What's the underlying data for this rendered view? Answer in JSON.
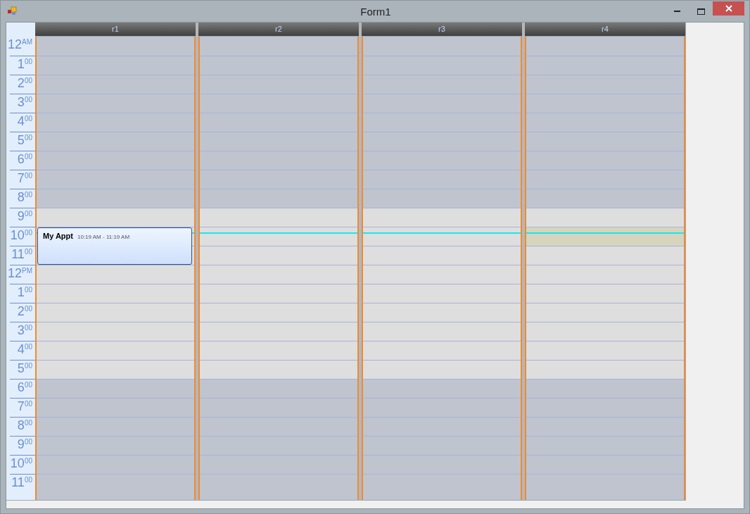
{
  "window": {
    "title": "Form1"
  },
  "columns": [
    {
      "label": "r1",
      "selected": false,
      "appointments": [
        {
          "title": "My Appt",
          "time": "10:19 AM - 11:19 AM"
        }
      ]
    },
    {
      "label": "r2",
      "selected": false
    },
    {
      "label": "r3",
      "selected": false
    },
    {
      "label": "r4",
      "selected": true
    }
  ],
  "hours": [
    {
      "hour": "12",
      "mark": "AM",
      "work": false,
      "now": false,
      "selected": false
    },
    {
      "hour": "1",
      "mark": "00",
      "work": false,
      "now": false,
      "selected": false
    },
    {
      "hour": "2",
      "mark": "00",
      "work": false,
      "now": false,
      "selected": false
    },
    {
      "hour": "3",
      "mark": "00",
      "work": false,
      "now": false,
      "selected": false
    },
    {
      "hour": "4",
      "mark": "00",
      "work": false,
      "now": false,
      "selected": false
    },
    {
      "hour": "5",
      "mark": "00",
      "work": false,
      "now": false,
      "selected": false
    },
    {
      "hour": "6",
      "mark": "00",
      "work": false,
      "now": false,
      "selected": false
    },
    {
      "hour": "7",
      "mark": "00",
      "work": false,
      "now": false,
      "selected": false
    },
    {
      "hour": "8",
      "mark": "00",
      "work": false,
      "now": false,
      "selected": false
    },
    {
      "hour": "9",
      "mark": "00",
      "work": true,
      "now": false,
      "selected": false
    },
    {
      "hour": "10",
      "mark": "00",
      "work": true,
      "now": true,
      "selected": true
    },
    {
      "hour": "11",
      "mark": "00",
      "work": true,
      "now": false,
      "selected": false
    },
    {
      "hour": "12",
      "mark": "PM",
      "work": true,
      "now": false,
      "selected": false
    },
    {
      "hour": "1",
      "mark": "00",
      "work": true,
      "now": false,
      "selected": false
    },
    {
      "hour": "2",
      "mark": "00",
      "work": true,
      "now": false,
      "selected": false
    },
    {
      "hour": "3",
      "mark": "00",
      "work": true,
      "now": false,
      "selected": false
    },
    {
      "hour": "4",
      "mark": "00",
      "work": true,
      "now": false,
      "selected": false
    },
    {
      "hour": "5",
      "mark": "00",
      "work": true,
      "now": false,
      "selected": false
    },
    {
      "hour": "6",
      "mark": "00",
      "work": false,
      "now": false,
      "selected": false
    },
    {
      "hour": "7",
      "mark": "00",
      "work": false,
      "now": false,
      "selected": false
    },
    {
      "hour": "8",
      "mark": "00",
      "work": false,
      "now": false,
      "selected": false
    },
    {
      "hour": "9",
      "mark": "00",
      "work": false,
      "now": false,
      "selected": false
    },
    {
      "hour": "10",
      "mark": "00",
      "work": false,
      "now": false,
      "selected": false
    },
    {
      "hour": "11",
      "mark": "00",
      "work": false,
      "now": false,
      "selected": false
    }
  ]
}
